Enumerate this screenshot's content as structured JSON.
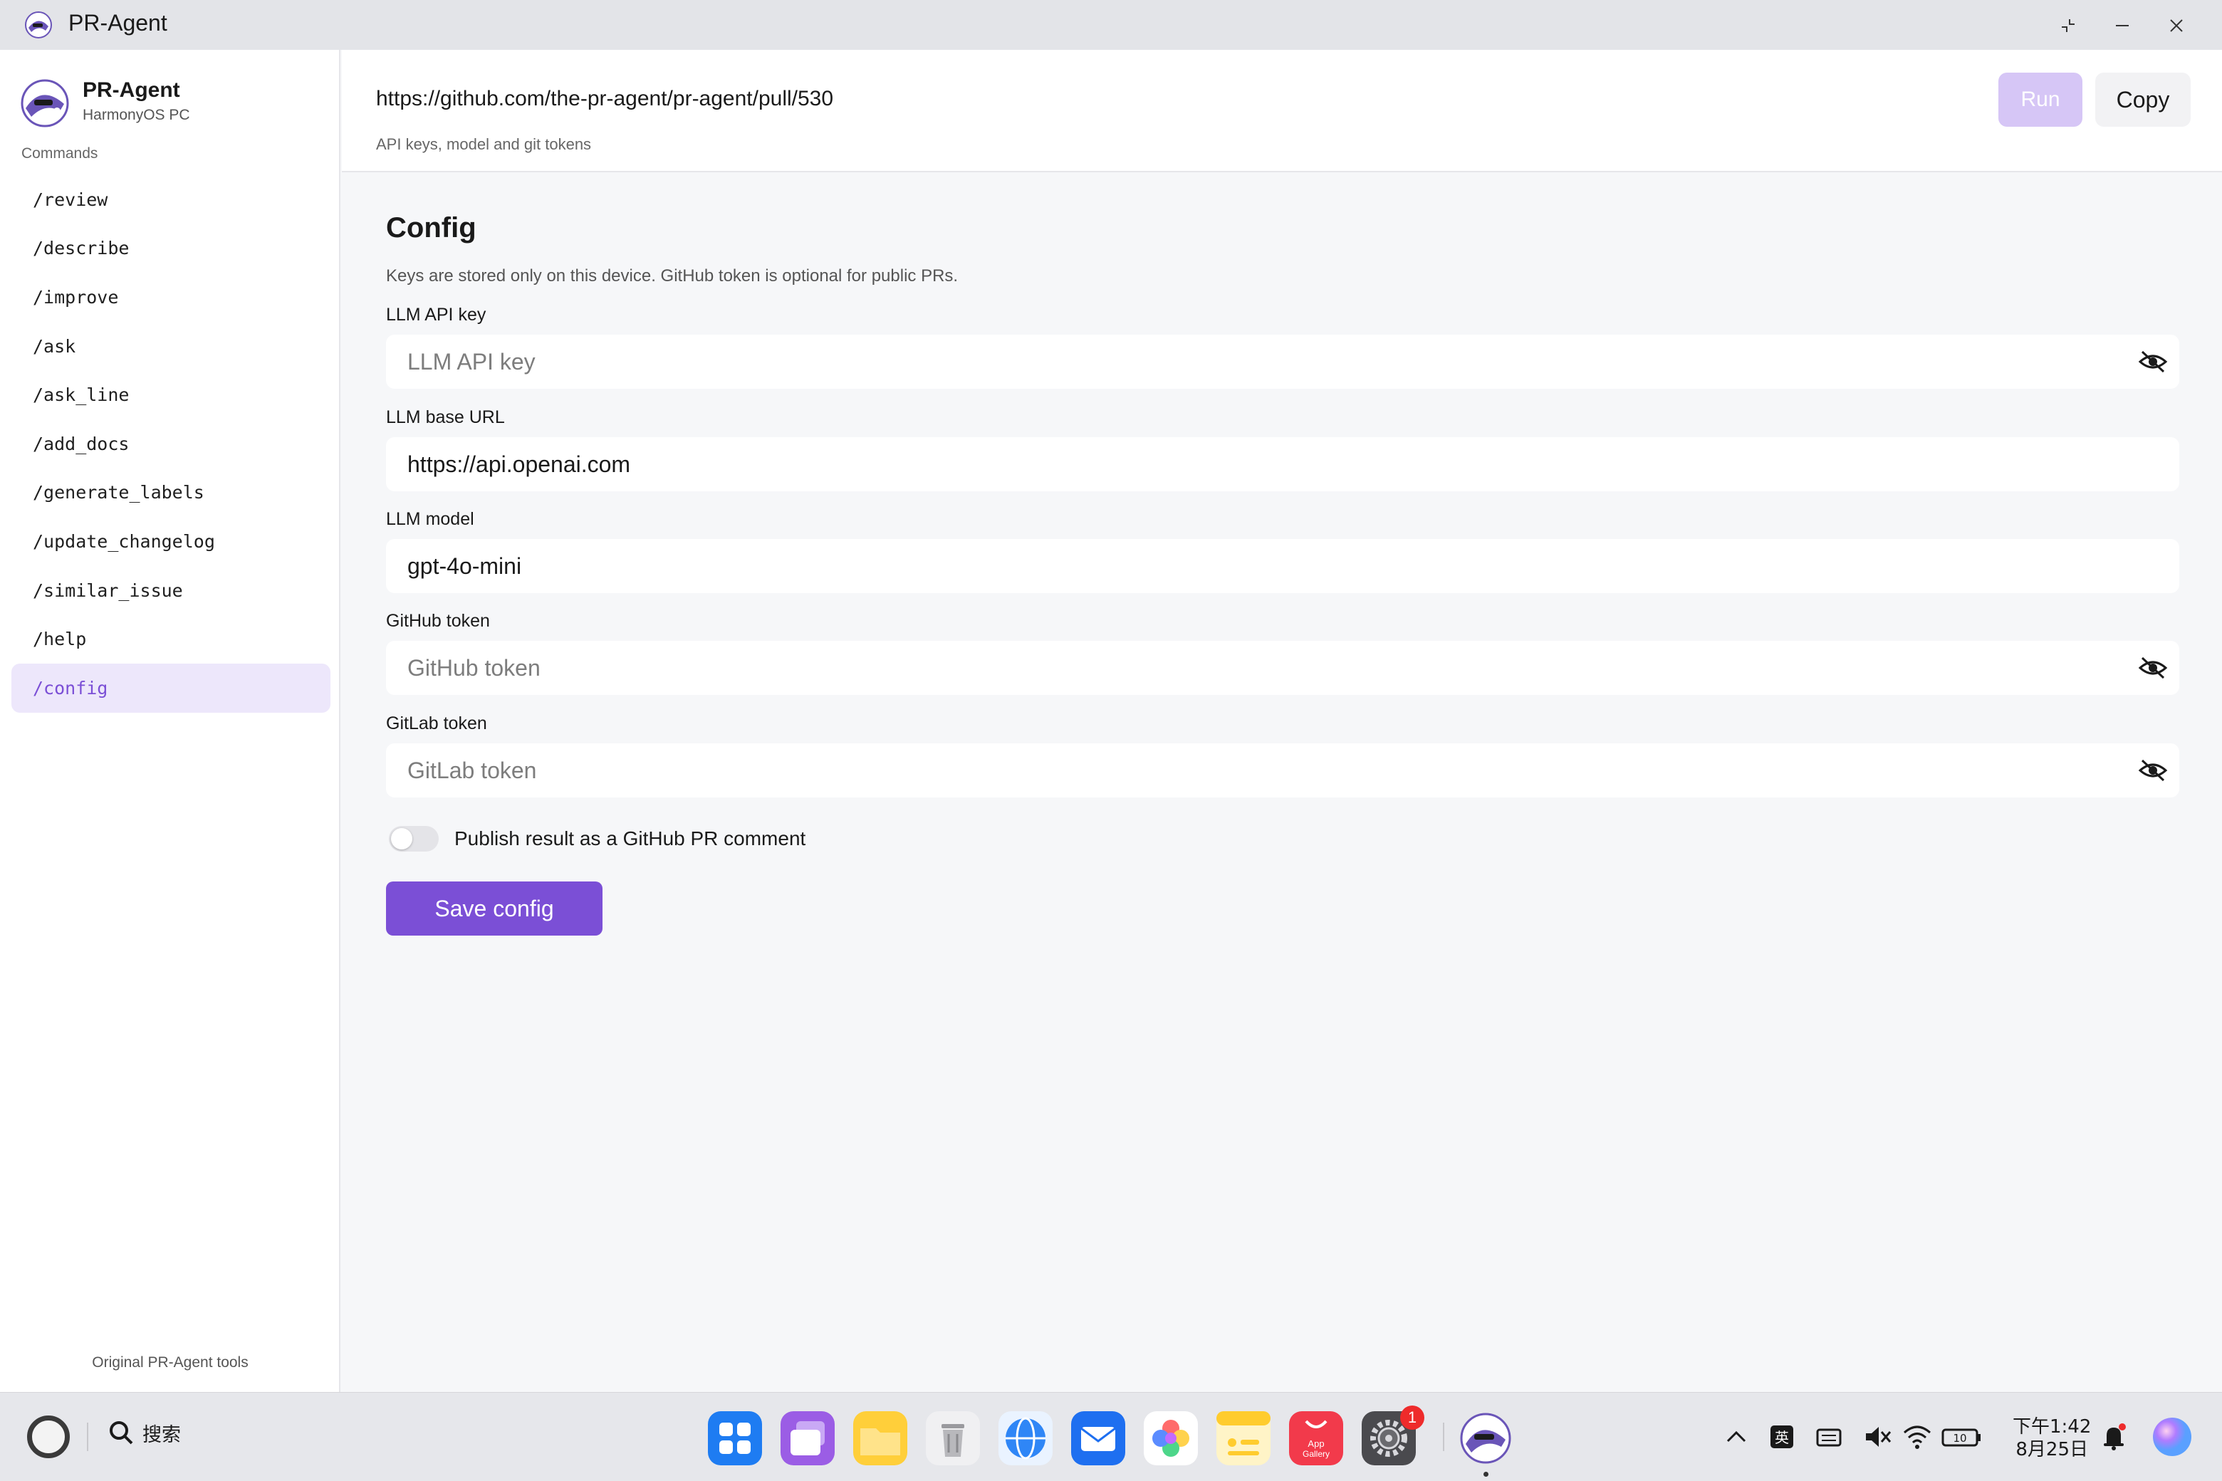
{
  "window": {
    "title": "PR-Agent"
  },
  "sidebar": {
    "brand_name": "PR-Agent",
    "brand_sub": "HarmonyOS PC",
    "section_label": "Commands",
    "items": [
      {
        "label": "/review"
      },
      {
        "label": "/describe"
      },
      {
        "label": "/improve"
      },
      {
        "label": "/ask"
      },
      {
        "label": "/ask_line"
      },
      {
        "label": "/add_docs"
      },
      {
        "label": "/generate_labels"
      },
      {
        "label": "/update_changelog"
      },
      {
        "label": "/similar_issue"
      },
      {
        "label": "/help"
      },
      {
        "label": "/config"
      }
    ],
    "active_item": "/config",
    "footer": "Original PR-Agent tools"
  },
  "topbar": {
    "url_value": "https://github.com/the-pr-agent/pr-agent/pull/530",
    "hint": "API keys, model and git tokens",
    "run_label": "Run",
    "copy_label": "Copy"
  },
  "config": {
    "title": "Config",
    "description": "Keys are stored only on this device. GitHub token is optional for public PRs.",
    "fields": {
      "llm_api_key": {
        "label": "LLM API key",
        "placeholder": "LLM API key",
        "value": ""
      },
      "llm_base_url": {
        "label": "LLM base URL",
        "value": "https://api.openai.com"
      },
      "llm_model": {
        "label": "LLM model",
        "value": "gpt-4o-mini"
      },
      "github_token": {
        "label": "GitHub token",
        "placeholder": "GitHub token",
        "value": ""
      },
      "gitlab_token": {
        "label": "GitLab token",
        "placeholder": "GitLab token",
        "value": ""
      }
    },
    "publish_toggle": {
      "label": "Publish result as a GitHub PR comment",
      "on": false
    },
    "save_label": "Save config"
  },
  "taskbar": {
    "search_label": "搜索",
    "dock_apps": [
      "app-launcher",
      "multitask",
      "files",
      "trash",
      "browser",
      "mail",
      "photos",
      "notes",
      "app-gallery",
      "settings",
      "pr-agent"
    ],
    "app_gallery_label": "App Gallery",
    "settings_badge": "1",
    "ime_label": "英",
    "battery_label": "10",
    "clock_time": "下午1:42",
    "clock_date": "8月25日"
  },
  "colors": {
    "accent": "#7b4fd6",
    "accent_light": "#ede7fb",
    "run_disabled": "#d6c6f6",
    "background": "#f6f7f9"
  }
}
